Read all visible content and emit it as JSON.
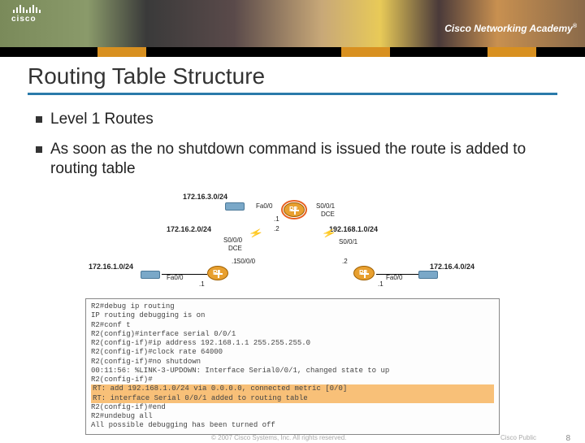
{
  "header": {
    "brand": "cisco",
    "academy": "Cisco Networking Academy"
  },
  "title": "Routing Table Structure",
  "bullets": {
    "b1": "Level 1 Routes",
    "b2": "As soon as the no shutdown command is issued the route is added to routing table"
  },
  "topology": {
    "net_top": "172.16.3.0/24",
    "net_mid_left": "172.16.2.0/24",
    "net_left": "172.16.1.0/24",
    "net_mid_right": "192.168.1.0/24",
    "net_right": "172.16.4.0/24",
    "if_fa00": "Fa0/0",
    "if_s001": "S0/0/1",
    "if_s000": "S0/0/0",
    "dce": "DCE",
    "ip1": ".1",
    "ip2": ".2",
    "r1": "R1",
    "r2": "R2",
    "r3": "R3"
  },
  "cli": {
    "l1": "R2#debug ip routing",
    "l2": "IP routing debugging is on",
    "l3": "R2#conf t",
    "l4": "R2(config)#interface serial 0/0/1",
    "l5": "R2(config-if)#ip address 192.168.1.1 255.255.255.0",
    "l6": "R2(config-if)#clock rate 64000",
    "l7": "R2(config-if)#no shutdown",
    "l8": "00:11:56: %LINK-3-UPDOWN: Interface Serial0/0/1, changed state to up",
    "l9": "R2(config-if)#",
    "l10": "RT: add 192.168.1.0/24 via 0.0.0.0, connected metric [0/0]",
    "l11": "RT: interface Serial 0/0/1 added to routing table",
    "l12": "R2(config-if)#end",
    "l13": "R2#undebug all",
    "l14": "All possible debugging has been turned off"
  },
  "footer": {
    "copyright": "© 2007 Cisco Systems, Inc. All rights reserved.",
    "public": "Cisco Public",
    "page": "8"
  }
}
